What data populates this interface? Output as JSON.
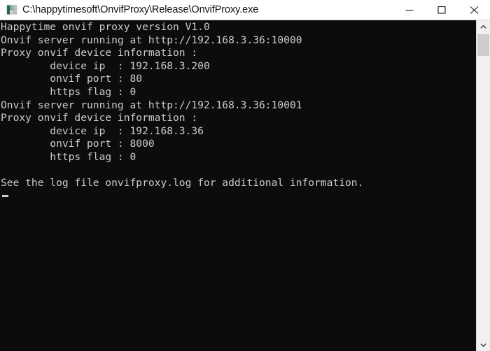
{
  "window": {
    "title": "C:\\happytimesoft\\OnvifProxy\\Release\\OnvifProxy.exe",
    "icon": "console-app-icon",
    "background_color": "#0c0c0c",
    "text_color": "#cccccc",
    "titlebar_background": "#ffffff",
    "titlebar_text_color": "#101010"
  },
  "titlebar_buttons": {
    "minimize_label": "—",
    "maximize_label": "□",
    "close_label": "✕"
  },
  "console": {
    "lines": [
      "Happytime onvif proxy version V1.0",
      "Onvif server running at http://192.168.3.36:10000",
      "Proxy onvif device information :",
      "        device ip  : 192.168.3.200",
      "        onvif port : 80",
      "        https flag : 0",
      "Onvif server running at http://192.168.3.36:10001",
      "Proxy onvif device information :",
      "        device ip  : 192.168.3.36",
      "        onvif port : 8000",
      "        https flag : 0",
      "",
      "See the log file onvifproxy.log for additional information."
    ],
    "text": "Happytime onvif proxy version V1.0\nOnvif server running at http://192.168.3.36:10000\nProxy onvif device information :\n        device ip  : 192.168.3.200\n        onvif port : 80\n        https flag : 0\nOnvif server running at http://192.168.3.36:10001\nProxy onvif device information :\n        device ip  : 192.168.3.36\n        onvif port : 8000\n        https flag : 0\n\nSee the log file onvifproxy.log for additional information.",
    "server_entries": [
      {
        "server_url": "http://192.168.3.36:10000",
        "device_ip": "192.168.3.200",
        "onvif_port": "80",
        "https_flag": "0"
      },
      {
        "server_url": "http://192.168.3.36:10001",
        "device_ip": "192.168.3.36",
        "onvif_port": "8000",
        "https_flag": "0"
      }
    ],
    "version_line": "Happytime onvif proxy version V1.0",
    "log_notice": "See the log file onvifproxy.log for additional information.",
    "log_file_name": "onvifproxy.log"
  },
  "scrollbar": {
    "up_arrow": "▲",
    "down_arrow": "▼",
    "thumb_color": "#cdcdcd",
    "track_color": "#f0f0f0"
  }
}
